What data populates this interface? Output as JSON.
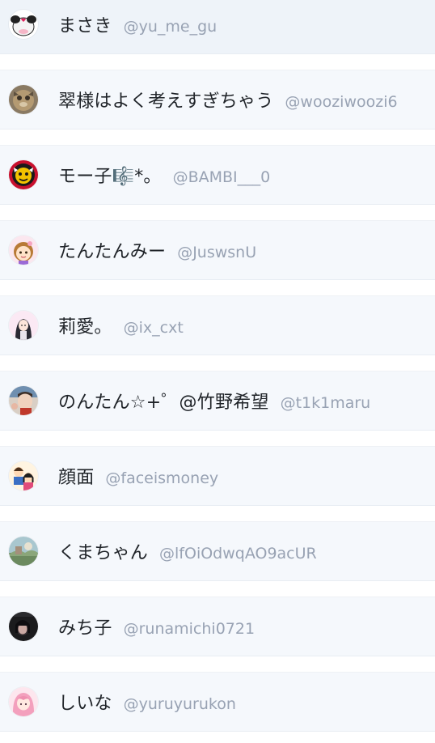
{
  "users": [
    {
      "display_name": "まさき",
      "handle": "@yu_me_gu",
      "avatar_icon": "cow-avatar-icon"
    },
    {
      "display_name": "翠様はよく考えすぎちゃう",
      "handle": "@wooziwoozi6",
      "avatar_icon": "cat-avatar-icon"
    },
    {
      "display_name": "モー子🎼*。",
      "handle": "@BAMBI___0",
      "avatar_icon": "logo-avatar-icon"
    },
    {
      "display_name": "たんたんみー",
      "handle": "@JuswsnU",
      "avatar_icon": "girl-avatar-icon"
    },
    {
      "display_name": "莉愛。",
      "handle": "@ix_cxt",
      "avatar_icon": "anime-girl-avatar-icon"
    },
    {
      "display_name": "のんたん☆+゜@竹野希望",
      "handle": "@t1k1maru",
      "avatar_icon": "photo-avatar-icon"
    },
    {
      "display_name": "顔面",
      "handle": "@faceismoney",
      "avatar_icon": "couple-avatar-icon"
    },
    {
      "display_name": "くまちゃん",
      "handle": "@lfOiOdwqAO9acUR",
      "avatar_icon": "landscape-avatar-icon"
    },
    {
      "display_name": "みち子",
      "handle": "@runamichi0721",
      "avatar_icon": "dark-photo-avatar-icon"
    },
    {
      "display_name": "しいな",
      "handle": "@yuruyurukon",
      "avatar_icon": "pink-hair-avatar-icon"
    }
  ]
}
